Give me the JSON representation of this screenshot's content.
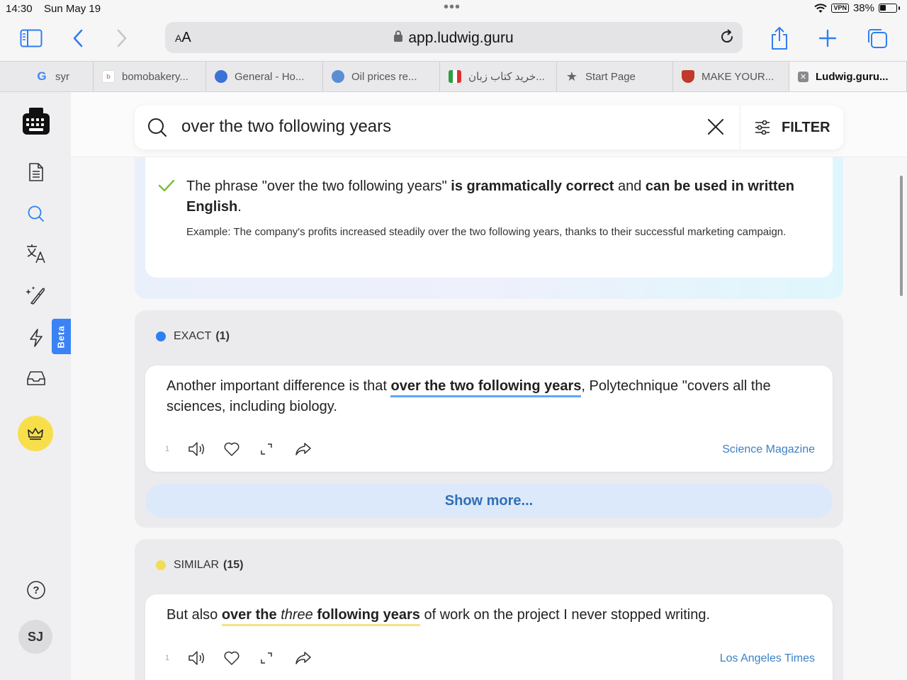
{
  "status": {
    "time": "14:30",
    "date": "Sun May 19",
    "vpn": "VPN",
    "battery": "38%"
  },
  "browser": {
    "aa_small": "A",
    "aa_big": "A",
    "url": "app.ludwig.guru",
    "tabs": [
      {
        "label": "syr",
        "icon": "google-icon"
      },
      {
        "label": "bomobakery...",
        "icon": "bomobakery-icon"
      },
      {
        "label": "General - Ho...",
        "icon": "balloon-icon"
      },
      {
        "label": "Oil prices re...",
        "icon": "globe-icon"
      },
      {
        "label": "خرید کتاب زبان...",
        "icon": "flag-icon"
      },
      {
        "label": "Start Page",
        "icon": "star-icon"
      },
      {
        "label": "MAKE YOUR...",
        "icon": "crest-icon"
      },
      {
        "label": "Ludwig.guru...",
        "icon": "close-icon"
      }
    ]
  },
  "sidebar": {
    "beta": "Beta",
    "avatar": "SJ",
    "help": "?"
  },
  "search": {
    "query": "over the two following years",
    "filter_label": "FILTER"
  },
  "answer": {
    "part1": "The phrase \"over the two following years\" ",
    "bold1": "is grammatically correct",
    "part2": " and ",
    "bold2": "can be used in written English",
    "part3": ".",
    "example": "Example: The company's profits increased steadily over the two following years, thanks to their successful marketing campaign."
  },
  "exact": {
    "label": "EXACT",
    "count": "(1)",
    "dot_color": "#2f7ff0",
    "card": {
      "before": "Another important difference is that ",
      "highlight": "over the two following years",
      "after": ", Polytechnique \"covers all the sciences, including biology.",
      "num": "1",
      "source": "Science Magazine"
    },
    "show_more": "Show more..."
  },
  "similar": {
    "label": "SIMILAR",
    "count": "(15)",
    "dot_color": "#f3dc56",
    "card": {
      "before": "But also ",
      "hl1": "over the ",
      "hl_italic": "three",
      "hl2": " following years",
      "after": " of work on the project I never stopped writing.",
      "num": "1",
      "source": "Los Angeles Times"
    }
  }
}
